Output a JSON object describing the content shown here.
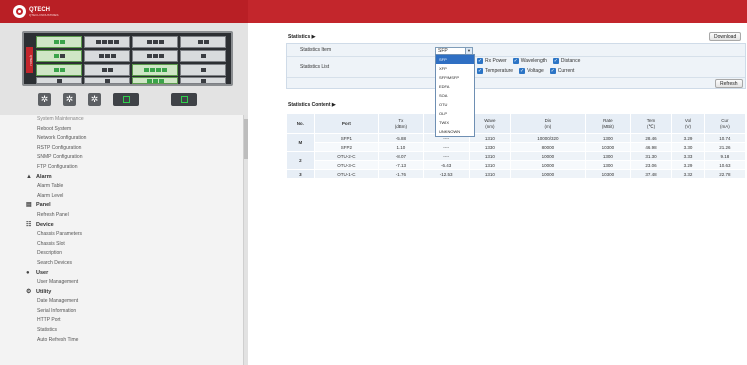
{
  "brand": {
    "name": "QTECH",
    "tagline": "QTECH INDUSTRIES",
    "chassis_label": "QTECH"
  },
  "nav": {
    "items": [
      {
        "type": "item",
        "label": "System Maintenance",
        "first": true
      },
      {
        "type": "item",
        "label": "Reboot System"
      },
      {
        "type": "item",
        "label": "Network Configuration"
      },
      {
        "type": "item",
        "label": "RSTP Configuration"
      },
      {
        "type": "item",
        "label": "SNMP Configuration"
      },
      {
        "type": "item",
        "label": "FTP Configuration"
      },
      {
        "type": "group",
        "label": "Alarm",
        "icon": "warning-icon"
      },
      {
        "type": "item",
        "label": "Alarm Table"
      },
      {
        "type": "item",
        "label": "Alarm Level"
      },
      {
        "type": "group",
        "label": "Panel",
        "icon": "panel-icon"
      },
      {
        "type": "item",
        "label": "Refresh Panel"
      },
      {
        "type": "group",
        "label": "Device",
        "icon": "device-icon"
      },
      {
        "type": "item",
        "label": "Chassis Parameters"
      },
      {
        "type": "item",
        "label": "Chassis Slot"
      },
      {
        "type": "item",
        "label": "Description"
      },
      {
        "type": "item",
        "label": "Search Devices"
      },
      {
        "type": "group",
        "label": "User",
        "icon": "user-icon"
      },
      {
        "type": "item",
        "label": "User Management"
      },
      {
        "type": "group",
        "label": "Utility",
        "icon": "utility-icon"
      },
      {
        "type": "item",
        "label": "Date Management"
      },
      {
        "type": "item",
        "label": "Serial Information"
      },
      {
        "type": "item",
        "label": "HTTP Port"
      },
      {
        "type": "item",
        "label": "Statistics"
      },
      {
        "type": "item",
        "label": "Auto Refresh Time"
      }
    ]
  },
  "statistics": {
    "title": "Statistics ▶",
    "download_label": "Download",
    "item_label": "Statistics Item",
    "list_label": "Statistics List",
    "selected_item": "SFP",
    "dropdown_options": [
      "SFP",
      "XFP",
      "SFP/MSFP",
      "EDFA",
      "SOA",
      "OTU",
      "OLP",
      "TWIX",
      "UNKNOWN"
    ],
    "checks_row1": [
      "Rx Power",
      "Wavelength",
      "Distance"
    ],
    "checks_row2": [
      "Temperature",
      "Voltage",
      "Current"
    ],
    "refresh_label": "Refresh"
  },
  "content_section": {
    "title": "Statistics Content ▶",
    "headers": [
      {
        "main": "No.",
        "unit": ""
      },
      {
        "main": "Port",
        "unit": ""
      },
      {
        "main": "Tx",
        "unit": "(dBm)"
      },
      {
        "main": "Rx",
        "unit": "(dBm)"
      },
      {
        "main": "Wave",
        "unit": "(nm)"
      },
      {
        "main": "Dis",
        "unit": "(m)"
      },
      {
        "main": "Rate",
        "unit": "(MBit)"
      },
      {
        "main": "Tem",
        "unit": "(℃)"
      },
      {
        "main": "Vol",
        "unit": "(V)"
      },
      {
        "main": "Cur",
        "unit": "(mA)"
      }
    ],
    "rows": [
      {
        "no": "M",
        "span": 2,
        "port": "SFP1",
        "tx": "-5.88",
        "rx": "----",
        "wave": "1310",
        "dis": "10000/320",
        "rate": "1300",
        "tem": "28.46",
        "vol": "3.29",
        "cur": "10.74"
      },
      {
        "no": "",
        "span": 0,
        "port": "SFP2",
        "tx": "1.10",
        "rx": "----",
        "wave": "1330",
        "dis": "80000",
        "rate": "10300",
        "tem": "46.98",
        "vol": "3.30",
        "cur": "21.26"
      },
      {
        "no": "2",
        "span": 2,
        "port": "OTU-2-C",
        "tx": "-8.07",
        "rx": "----",
        "wave": "1310",
        "dis": "10000",
        "rate": "1300",
        "tem": "31.30",
        "vol": "3.33",
        "cur": "9.18"
      },
      {
        "no": "",
        "span": 0,
        "port": "OTU-3-C",
        "tx": "-7.13",
        "rx": "-6.43",
        "wave": "1310",
        "dis": "10000",
        "rate": "1300",
        "tem": "23.06",
        "vol": "3.29",
        "cur": "10.63"
      },
      {
        "no": "3",
        "span": 1,
        "port": "OTU-1-C",
        "tx": "-1.76",
        "rx": "-12.53",
        "wave": "1310",
        "dis": "10000",
        "rate": "10300",
        "tem": "37.48",
        "vol": "3.32",
        "cur": "22.78"
      }
    ]
  },
  "colors": {
    "header_red": "#c3262c",
    "table_blue": "#e7eef6",
    "check_blue": "#2b74c5"
  }
}
